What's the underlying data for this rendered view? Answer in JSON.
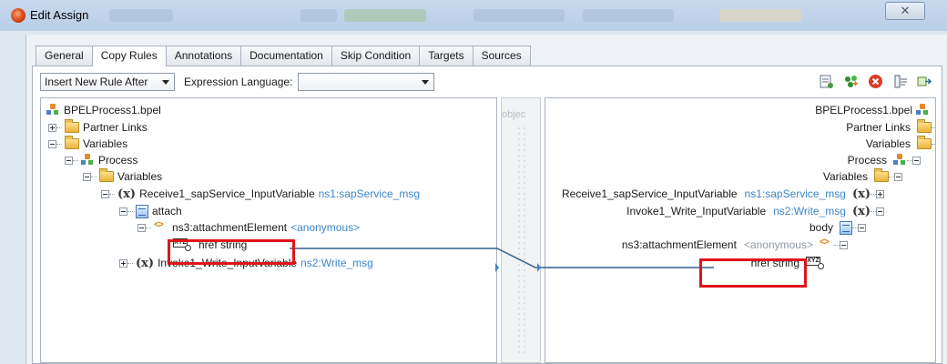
{
  "window": {
    "title": "Edit Assign",
    "close_glyph": "✕"
  },
  "tabs": [
    {
      "label": "General"
    },
    {
      "label": "Copy Rules"
    },
    {
      "label": "Annotations"
    },
    {
      "label": "Documentation"
    },
    {
      "label": "Skip Condition"
    },
    {
      "label": "Targets"
    },
    {
      "label": "Sources"
    }
  ],
  "active_tab": "Copy Rules",
  "toolbar": {
    "rule_select_value": "Insert New Rule After",
    "expression_language_label": "Expression Language:",
    "expression_language_value": "",
    "icons": [
      "sort-icon",
      "add-rule-icon",
      "delete-icon",
      "properties-icon",
      "expand-icon"
    ]
  },
  "middle": {
    "text": "objec"
  },
  "source_tree": {
    "root": "BPELProcess1.bpel",
    "partner_links": "Partner Links",
    "variables": "Variables",
    "process": "Process",
    "process_variables": "Variables",
    "receive_var": "Receive1_sapService_InputVariable",
    "receive_type": "ns1:sapService_msg",
    "attach": "attach",
    "attachment_element": "ns3:attachmentElement",
    "attachment_type": "<anonymous>",
    "href": "href string",
    "invoke_var": "Invoke1_Write_InputVariable",
    "invoke_type": "ns2:Write_msg"
  },
  "target_tree": {
    "root": "BPELProcess1.bpel",
    "partner_links": "Partner Links",
    "variables": "Variables",
    "process": "Process",
    "process_variables": "Variables",
    "receive_var": "Receive1_sapService_InputVariable",
    "receive_type": "ns1:sapService_msg",
    "invoke_var": "Invoke1_Write_InputVariable",
    "invoke_type": "ns2:Write_msg",
    "body": "body",
    "attachment_element": "ns3:attachmentElement",
    "attachment_type": "<anonymous>",
    "href": "href string"
  },
  "colors": {
    "highlight": "#e0141c",
    "namespace": "#3d86c9",
    "connector": "#2f5e8f"
  }
}
